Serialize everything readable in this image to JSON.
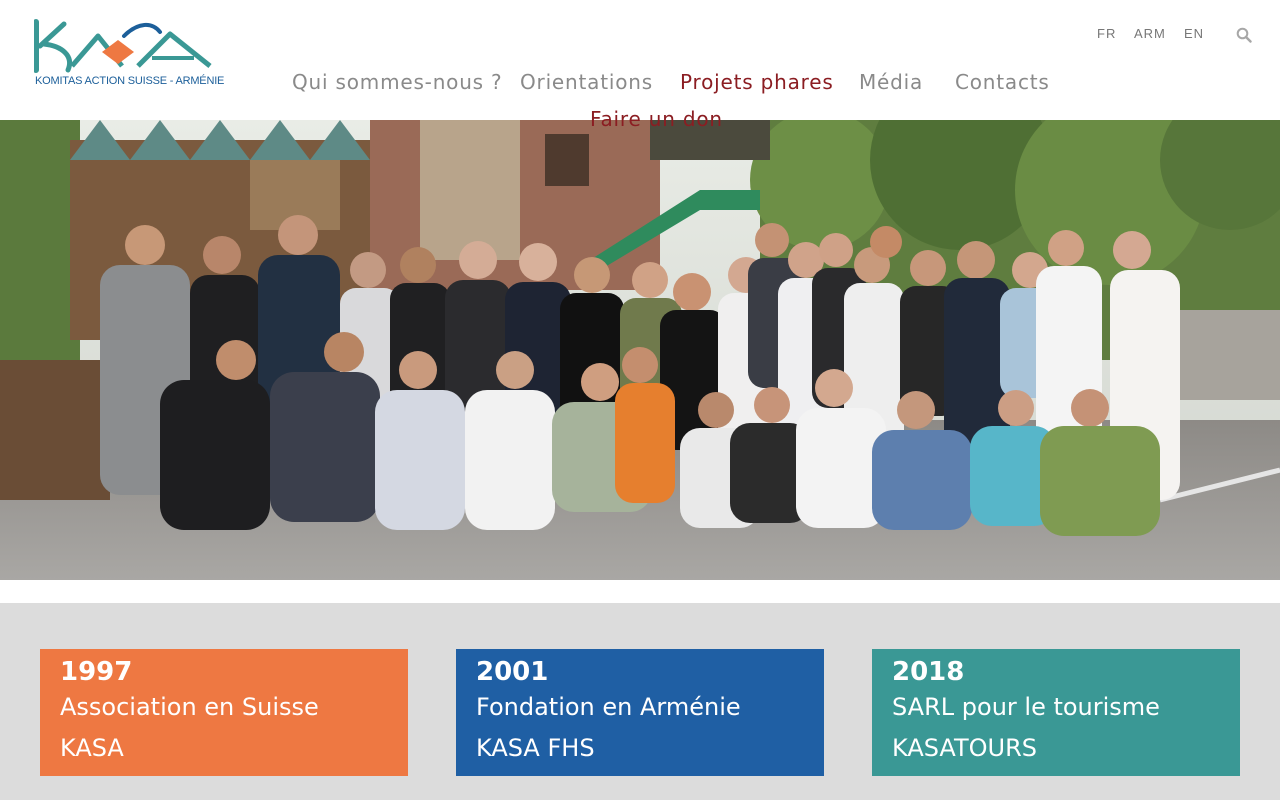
{
  "logo": {
    "wordmark": "KASA",
    "tagline": "KOMITAS ACTION SUISSE - ARMÉNIE",
    "colors": {
      "teal": "#3a9895",
      "orange": "#ee7842",
      "blue": "#1c5f9a"
    }
  },
  "languages": [
    "FR",
    "ARM",
    "EN"
  ],
  "search": {
    "icon": "search-icon"
  },
  "nav": {
    "items": [
      {
        "label": "Qui sommes-nous ?",
        "active": false
      },
      {
        "label": "Orientations",
        "active": false
      },
      {
        "label": "Projets phares",
        "active": true
      },
      {
        "label": "Média",
        "active": false
      },
      {
        "label": "Contacts",
        "active": false
      }
    ],
    "donate": "Faire un don",
    "active_color": "#8b1d22",
    "color": "#8a8a8a"
  },
  "hero": {
    "image": "group-photo"
  },
  "cards": [
    {
      "year": "1997",
      "line1": "Association en Suisse",
      "line2": "KASA",
      "color": "#ee7842"
    },
    {
      "year": "2001",
      "line1": "Fondation en Arménie",
      "line2": "KASA FHS",
      "color": "#1f5fa4"
    },
    {
      "year": "2018",
      "line1": "SARL pour le tourisme",
      "line2": "KASATOURS",
      "color": "#3a9895"
    }
  ]
}
